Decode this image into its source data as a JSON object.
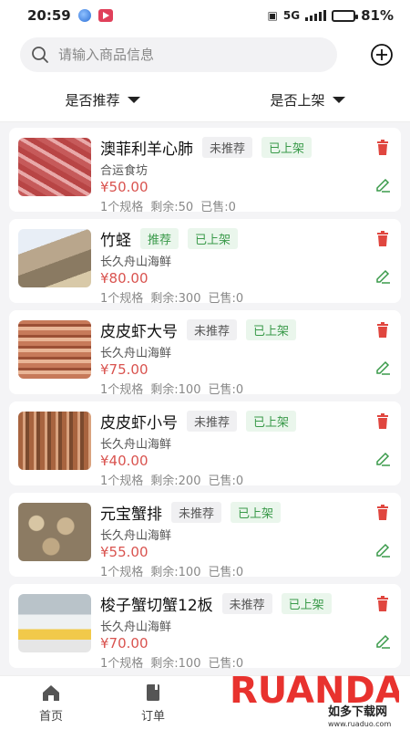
{
  "status_bar": {
    "time": "20:59",
    "network": "5G",
    "battery": "81%",
    "battery_level": 0.81
  },
  "search": {
    "placeholder": "请输入商品信息"
  },
  "filters": {
    "recommend": "是否推荐",
    "listed": "是否上架"
  },
  "products": [
    {
      "name": "澳菲利羊心肺",
      "recommend": "未推荐",
      "listed": "已上架",
      "shop": "合运食坊",
      "price": "¥50.00",
      "specs": "1个规格",
      "remaining": "剩余:50",
      "sold": "已售:0",
      "thumb": "meat"
    },
    {
      "name": "竹蛏",
      "recommend": "推荐",
      "listed": "已上架",
      "shop": "长久舟山海鲜",
      "price": "¥80.00",
      "specs": "1个规格",
      "remaining": "剩余:300",
      "sold": "已售:0",
      "thumb": "clam"
    },
    {
      "name": "皮皮虾大号",
      "recommend": "未推荐",
      "listed": "已上架",
      "shop": "长久舟山海鲜",
      "price": "¥75.00",
      "specs": "1个规格",
      "remaining": "剩余:100",
      "sold": "已售:0",
      "thumb": "shrimp"
    },
    {
      "name": "皮皮虾小号",
      "recommend": "未推荐",
      "listed": "已上架",
      "shop": "长久舟山海鲜",
      "price": "¥40.00",
      "specs": "1个规格",
      "remaining": "剩余:200",
      "sold": "已售:0",
      "thumb": "shrimp2"
    },
    {
      "name": "元宝蟹排",
      "recommend": "未推荐",
      "listed": "已上架",
      "shop": "长久舟山海鲜",
      "price": "¥55.00",
      "specs": "1个规格",
      "remaining": "剩余:100",
      "sold": "已售:0",
      "thumb": "crab"
    },
    {
      "name": "梭子蟹切蟹12板",
      "recommend": "未推荐",
      "listed": "已上架",
      "shop": "长久舟山海鲜",
      "price": "¥70.00",
      "specs": "1个规格",
      "remaining": "剩余:100",
      "sold": "已售:0",
      "thumb": "box"
    }
  ],
  "tabs": [
    {
      "label": "首页",
      "icon": "home-icon"
    },
    {
      "label": "订单",
      "icon": "order-icon"
    }
  ],
  "watermark": {
    "brand": "RUANDADO",
    "text": "如多下载网",
    "url": "www.ruaduo.com"
  },
  "colors": {
    "price": "#d9534f",
    "green_tag": "#3a9a4a",
    "delete": "#e0463f",
    "edit": "#3a9a4a"
  }
}
